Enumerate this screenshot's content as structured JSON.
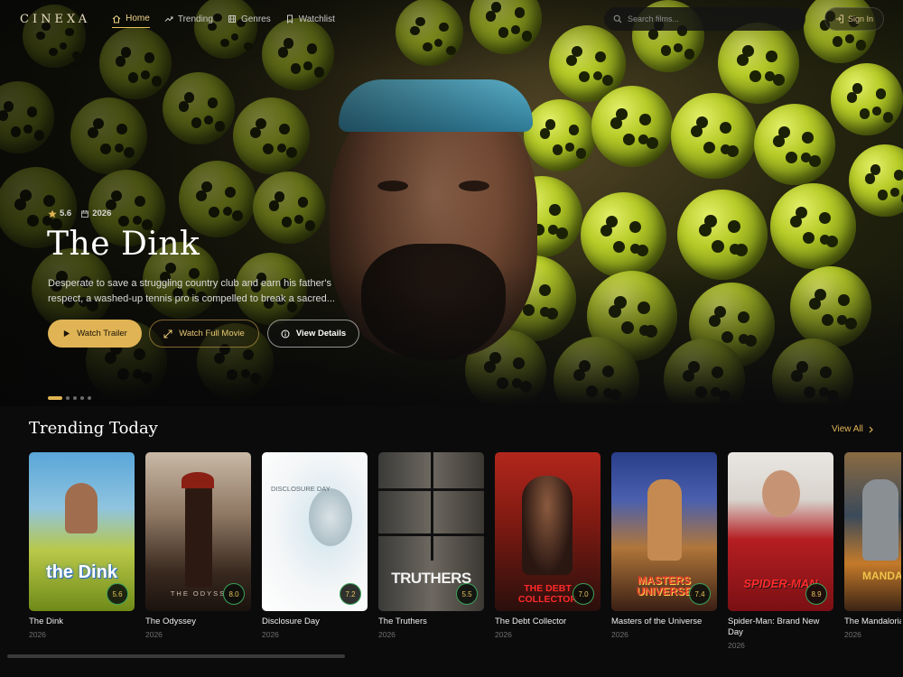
{
  "app": {
    "logo": "CINEXA"
  },
  "nav": {
    "items": [
      {
        "label": "Home",
        "icon": "home-icon",
        "active": true
      },
      {
        "label": "Trending",
        "icon": "trending-icon",
        "active": false
      },
      {
        "label": "Genres",
        "icon": "film-icon",
        "active": false
      },
      {
        "label": "Watchlist",
        "icon": "bookmark-icon",
        "active": false
      }
    ],
    "search_placeholder": "Search films...",
    "signin_label": "Sign In"
  },
  "hero": {
    "rating": "5.6",
    "year": "2026",
    "title": "The Dink",
    "description": "Desperate to save a struggling country club and earn his father's respect, a washed-up tennis pro is compelled to break a sacred...",
    "buttons": {
      "trailer": "Watch Trailer",
      "full_movie": "Watch Full Movie",
      "details": "View Details"
    },
    "slides": 5,
    "active_slide": 1
  },
  "trending": {
    "title": "Trending Today",
    "view_all": "View All",
    "movies": [
      {
        "title": "The Dink",
        "year": "2026",
        "rating": "5.6",
        "poster_text": "the Dink"
      },
      {
        "title": "The Odyssey",
        "year": "2026",
        "rating": "8.0",
        "poster_text": "THE ODYSS"
      },
      {
        "title": "Disclosure Day",
        "year": "2026",
        "rating": "7.2",
        "poster_text": "DISCLOSURE DAY"
      },
      {
        "title": "The Truthers",
        "year": "2026",
        "rating": "5.5",
        "poster_text": "TRUTHERS"
      },
      {
        "title": "The Debt Collector",
        "year": "2026",
        "rating": "7.0",
        "poster_text": "THE DEBT COLLECTOR"
      },
      {
        "title": "Masters of the Universe",
        "year": "2026",
        "rating": "7.4",
        "poster_text": "MASTERS UNIVERSE"
      },
      {
        "title": "Spider-Man: Brand New Day",
        "year": "2026",
        "rating": "8.9",
        "poster_text": "SPIDER-MAN"
      },
      {
        "title": "The Mandalorian & Grogu",
        "year": "2026",
        "rating": "",
        "poster_text": "MANDALO"
      }
    ]
  },
  "colors": {
    "accent": "#e0b454",
    "rating_ring": "#3aa25a",
    "background": "#0b0b0c"
  }
}
